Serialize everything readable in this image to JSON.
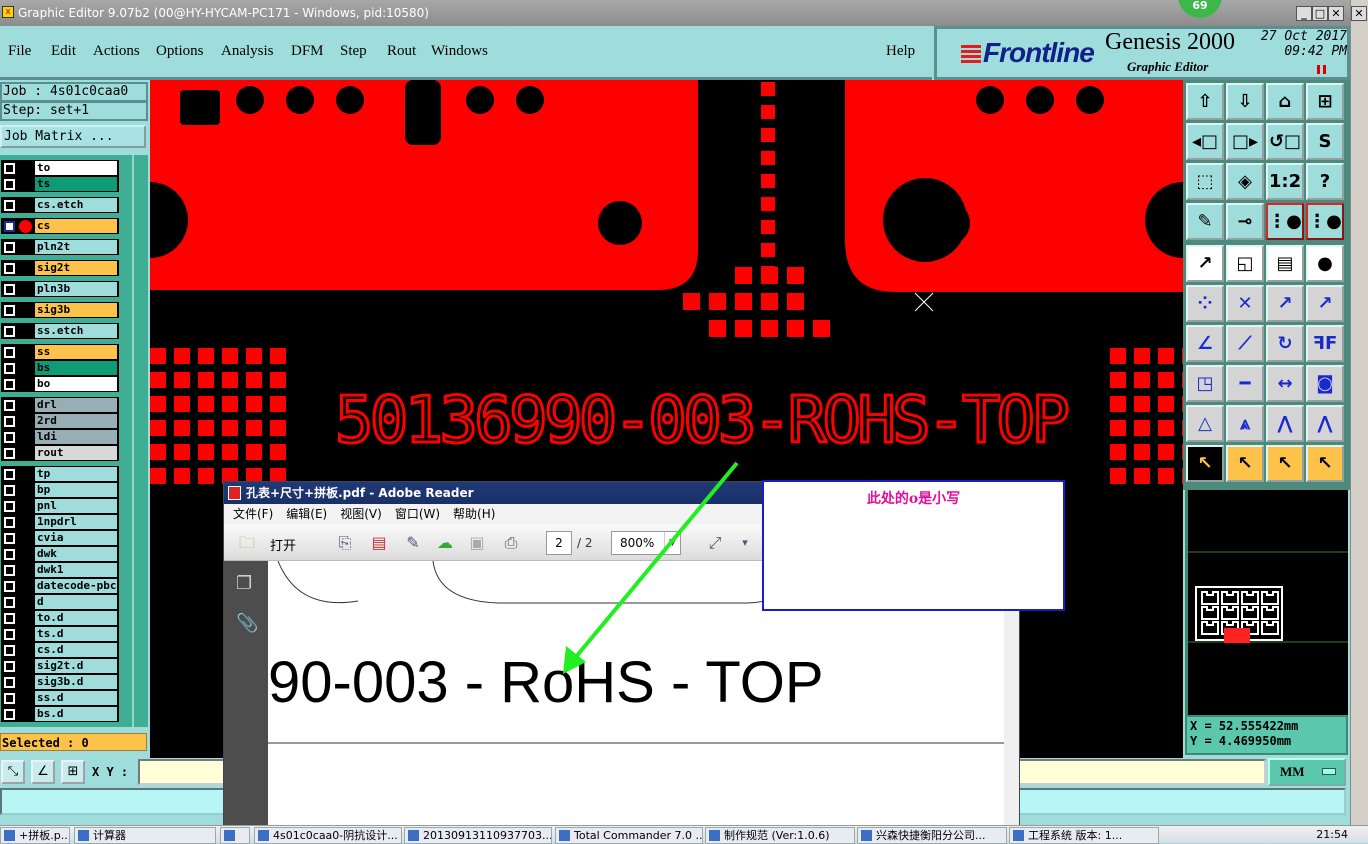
{
  "window": {
    "title": "Graphic Editor 9.07b2 (00@HY-HYCAM-PC171 - Windows, pid:10580)",
    "badge": "69",
    "min": "_",
    "max": "□",
    "close": "✕",
    "outer_close": "✕"
  },
  "menu": [
    {
      "label": "File"
    },
    {
      "label": "Edit"
    },
    {
      "label": "Actions"
    },
    {
      "label": "Options"
    },
    {
      "label": "Analysis"
    },
    {
      "label": "DFM"
    },
    {
      "label": "Step"
    },
    {
      "label": "Rout"
    },
    {
      "label": "Windows"
    }
  ],
  "help": "Help",
  "brand": {
    "logo": "Frontline",
    "product": "Genesis 2000",
    "subtitle": "Graphic Editor",
    "date": "27 Oct 2017",
    "time": "09:42 PM"
  },
  "job": {
    "job": "Job : 4s01c0caa0",
    "step": "Step: set+1",
    "job_matrix": "Job Matrix ...",
    "selected": "Selected : 0"
  },
  "layers": [
    {
      "name": "to",
      "color": "#ffffff"
    },
    {
      "name": "ts",
      "color": "#0f9a78"
    },
    {
      "name": "cs.etch",
      "color": "#9fdcdc"
    },
    {
      "name": "cs",
      "color": "#fcc24a",
      "active": true
    },
    {
      "name": "pln2t",
      "color": "#9fdcdc"
    },
    {
      "name": "sig2t",
      "color": "#fcc24a"
    },
    {
      "name": "pln3b",
      "color": "#9fdcdc"
    },
    {
      "name": "sig3b",
      "color": "#fcc24a"
    },
    {
      "name": "ss.etch",
      "color": "#9fdcdc"
    },
    {
      "name": "ss",
      "color": "#fcc24a"
    },
    {
      "name": "bs",
      "color": "#0f9a78"
    },
    {
      "name": "bo",
      "color": "#ffffff"
    },
    {
      "name": "drl",
      "color": "#97aeb4"
    },
    {
      "name": "2rd",
      "color": "#97aeb4"
    },
    {
      "name": "ldi",
      "color": "#97aeb4"
    },
    {
      "name": "rout",
      "color": "#d8d8d8"
    },
    {
      "name": "tp",
      "color": "#9fdcdc"
    },
    {
      "name": "bp",
      "color": "#9fdcdc"
    },
    {
      "name": "pnl",
      "color": "#9fdcdc"
    },
    {
      "name": "1npdrl",
      "color": "#9fdcdc"
    },
    {
      "name": "cvia",
      "color": "#9fdcdc"
    },
    {
      "name": "dwk",
      "color": "#9fdcdc"
    },
    {
      "name": "dwk1",
      "color": "#9fdcdc"
    },
    {
      "name": "datecode-pbc",
      "color": "#9fdcdc"
    },
    {
      "name": "d",
      "color": "#9fdcdc"
    },
    {
      "name": "to.d",
      "color": "#9fdcdc"
    },
    {
      "name": "ts.d",
      "color": "#9fdcdc"
    },
    {
      "name": "cs.d",
      "color": "#9fdcdc"
    },
    {
      "name": "sig2t.d",
      "color": "#9fdcdc"
    },
    {
      "name": "sig3b.d",
      "color": "#9fdcdc"
    },
    {
      "name": "ss.d",
      "color": "#9fdcdc"
    },
    {
      "name": "bs.d",
      "color": "#9fdcdc"
    }
  ],
  "canvas": {
    "board_text": "50136990-003-ROHS-TOP",
    "copper_color": "#ff0000"
  },
  "toolbox": [
    {
      "icon": "zoom-up-icon",
      "g": "⇧"
    },
    {
      "icon": "zoom-down-icon",
      "g": "⇩"
    },
    {
      "icon": "home-icon",
      "g": "⌂"
    },
    {
      "icon": "grid-xy-icon",
      "g": "⊞"
    },
    {
      "icon": "pan-left-icon",
      "g": "◂□"
    },
    {
      "icon": "pan-right-icon",
      "g": "□▸"
    },
    {
      "icon": "undo-view-icon",
      "g": "↺□"
    },
    {
      "icon": "snap-icon",
      "g": "S"
    },
    {
      "icon": "fit-all-icon",
      "g": "⬚"
    },
    {
      "icon": "fit-profile-icon",
      "g": "◈"
    },
    {
      "icon": "scale-1-2-icon",
      "g": "1:2"
    },
    {
      "icon": "help-icon",
      "g": "?"
    },
    {
      "icon": "tools-palette-icon",
      "g": "✎"
    },
    {
      "icon": "pad-icon",
      "g": "⊸"
    },
    {
      "icon": "netlist-icon",
      "g": "⋮●"
    },
    {
      "icon": "netlist-check-icon",
      "g": "⋮●"
    },
    {
      "icon": "add-feature-icon",
      "g": "↗"
    },
    {
      "icon": "select-area-icon",
      "g": "◱"
    },
    {
      "icon": "ruler-icon",
      "g": "▤"
    },
    {
      "icon": "pad-select-icon",
      "g": "●"
    },
    {
      "icon": "connect-pads-icon",
      "g": "⁘"
    },
    {
      "icon": "delete-icon",
      "g": "✕"
    },
    {
      "icon": "move-icon",
      "g": "↗"
    },
    {
      "icon": "copy-icon",
      "g": "↗"
    },
    {
      "icon": "angle-icon",
      "g": "∠"
    },
    {
      "icon": "line-icon",
      "g": "⟋"
    },
    {
      "icon": "rotate-icon",
      "g": "↻"
    },
    {
      "icon": "mirror-icon",
      "g": "ꟻF"
    },
    {
      "icon": "resize-icon",
      "g": "◳"
    },
    {
      "icon": "segment-icon",
      "g": "━"
    },
    {
      "icon": "dimension-icon",
      "g": "↔"
    },
    {
      "icon": "merge-icon",
      "g": "◙"
    },
    {
      "icon": "arc-triangle-icon",
      "g": "△"
    },
    {
      "icon": "double-triangle-icon",
      "g": "⩓"
    },
    {
      "icon": "arch-icon",
      "g": "⋀"
    },
    {
      "icon": "arch-line-icon",
      "g": "⋀"
    },
    {
      "icon": "pointer-icon",
      "g": "↖"
    },
    {
      "icon": "pointer-rect-icon",
      "g": "↖"
    },
    {
      "icon": "pointer-poly-icon",
      "g": "↖"
    },
    {
      "icon": "pointer-route-icon",
      "g": "↖"
    }
  ],
  "coords": {
    "x": "X = 52.555422mm",
    "y": "Y = 4.469950mm"
  },
  "xy": {
    "label": "X Y :",
    "value": "",
    "units": "MM"
  },
  "pdf": {
    "title": "孔表+尺寸+拼板.pdf - Adobe Reader",
    "menu": [
      "文件(F)",
      "编辑(E)",
      "视图(V)",
      "窗口(W)",
      "帮助(H)"
    ],
    "open": "打开",
    "page": "2",
    "page_total": "/ 2",
    "zoom": "800%",
    "text": "90-003 - RoHS - TOP"
  },
  "note": {
    "text": "此处的o是小写",
    "arrow_color": "#22ee22"
  },
  "taskbar": [
    {
      "label": "+拼板.p..."
    },
    {
      "label": "计算器"
    },
    {
      "label": ""
    },
    {
      "label": "4s01c0caa0-阴抗设计..."
    },
    {
      "label": "20130913110937703..."
    },
    {
      "label": "Total Commander 7.0 ..."
    },
    {
      "label": "制作规范 (Ver:1.0.6)"
    },
    {
      "label": "兴森快捷衡阳分公司..."
    },
    {
      "label": "工程系统  版本: 1..."
    }
  ],
  "clock": "21:54"
}
